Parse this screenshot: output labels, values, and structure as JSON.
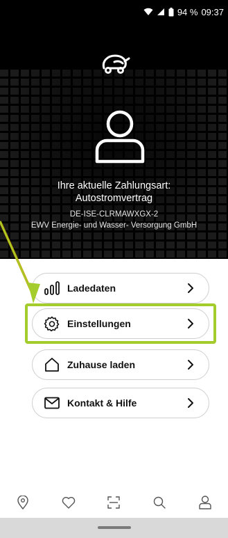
{
  "status_bar": {
    "battery": "94 %",
    "time": "09:37",
    "icons": [
      "wifi-icon",
      "cell-signal-icon",
      "battery-icon"
    ]
  },
  "header": {
    "logo_icon": "car-plug-logo",
    "avatar_icon": "user-outline-icon",
    "payment_label_line1": "Ihre aktuelle Zahlungsart:",
    "payment_label_line2": "Autostromvertrag",
    "contract_id": "DE-ISE-CLRMAWXGX-2",
    "provider": "EWV Energie- und Wasser- Versorgung GmbH"
  },
  "menu": [
    {
      "label": "Ladedaten",
      "icon": "bar-chart-icon"
    },
    {
      "label": "Einstellungen",
      "icon": "gear-icon"
    },
    {
      "label": "Zuhause laden",
      "icon": "home-icon"
    },
    {
      "label": "Kontakt & Hilfe",
      "icon": "mail-icon"
    }
  ],
  "bottom_nav": [
    {
      "icon": "map-pin-icon"
    },
    {
      "icon": "heart-icon"
    },
    {
      "icon": "scan-icon"
    },
    {
      "icon": "search-icon"
    },
    {
      "icon": "profile-icon"
    }
  ],
  "colors": {
    "header_bg": "#000000",
    "highlight": "#a3cc2c",
    "annotation": "#a3cc2c"
  }
}
